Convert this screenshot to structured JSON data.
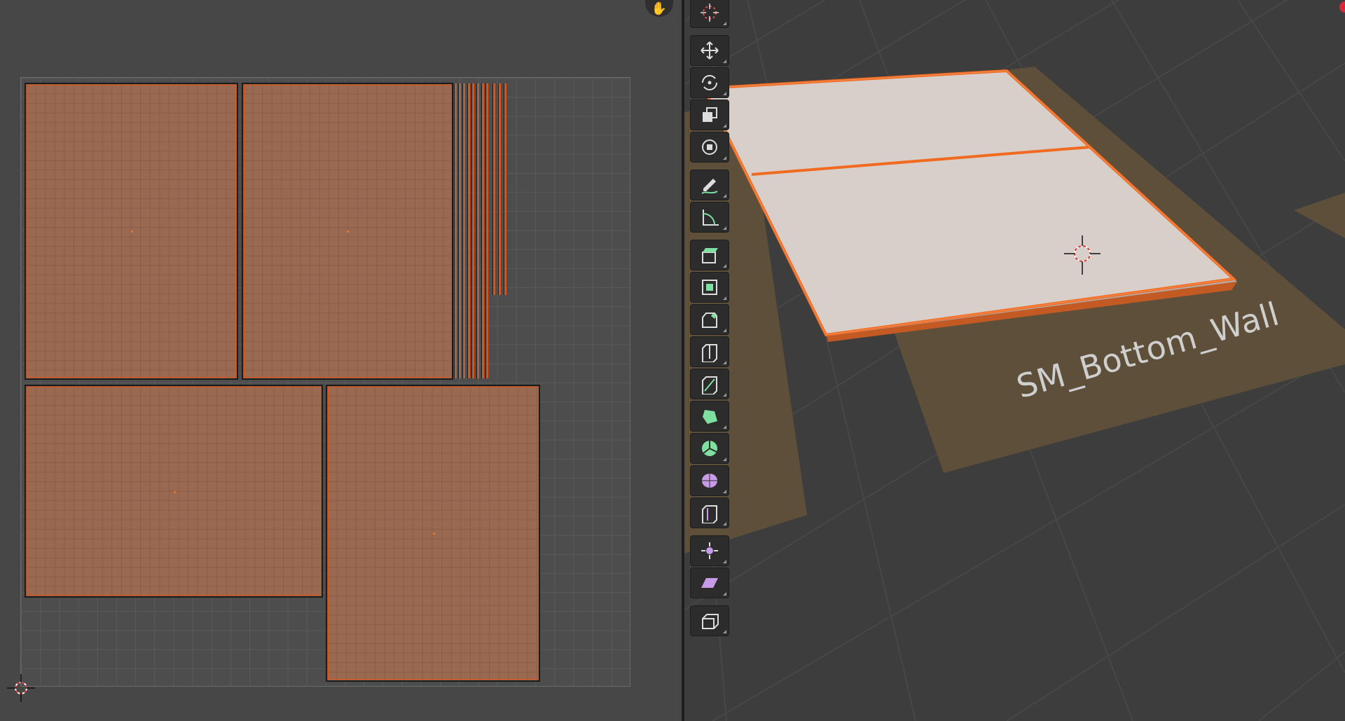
{
  "uv_editor": {
    "hand_icon": "hand-pan-icon",
    "cursor_icon": "2d-cursor-icon"
  },
  "viewport": {
    "object_name": "SM_Bottom_Wall",
    "cursor_icon": "3d-cursor-icon",
    "record_indicator_color": "#d8293b"
  },
  "toolbar": {
    "tools": [
      {
        "name": "cursor-tool",
        "icon": "cursor-icon"
      },
      {
        "name": "move-tool",
        "icon": "move-icon"
      },
      {
        "name": "rotate-tool",
        "icon": "rotate-icon"
      },
      {
        "name": "scale-tool",
        "icon": "scale-icon"
      },
      {
        "name": "transform-tool",
        "icon": "transform-icon"
      },
      {
        "name": "annotate-tool",
        "icon": "annotate-icon"
      },
      {
        "name": "measure-tool",
        "icon": "measure-icon"
      },
      {
        "name": "extrude-tool",
        "icon": "extrude-region-icon"
      },
      {
        "name": "inset-tool",
        "icon": "inset-faces-icon"
      },
      {
        "name": "bevel-tool",
        "icon": "bevel-icon"
      },
      {
        "name": "loop-cut-tool",
        "icon": "loop-cut-icon"
      },
      {
        "name": "knife-tool",
        "icon": "knife-icon"
      },
      {
        "name": "poly-build-tool",
        "icon": "poly-build-icon"
      },
      {
        "name": "spin-tool",
        "icon": "spin-icon"
      },
      {
        "name": "smooth-tool",
        "icon": "smooth-vertices-icon"
      },
      {
        "name": "edge-slide-tool",
        "icon": "edge-slide-icon"
      },
      {
        "name": "shrink-fatten-tool",
        "icon": "shrink-fatten-icon"
      },
      {
        "name": "shear-tool",
        "icon": "shear-icon"
      },
      {
        "name": "rip-region-tool",
        "icon": "rip-region-icon"
      }
    ]
  },
  "colors": {
    "selection": "#e0541a",
    "uv_island": "#9a6951",
    "active_tool_icon": "#7ee0a0",
    "sculpt_icon": "#c79be8"
  }
}
